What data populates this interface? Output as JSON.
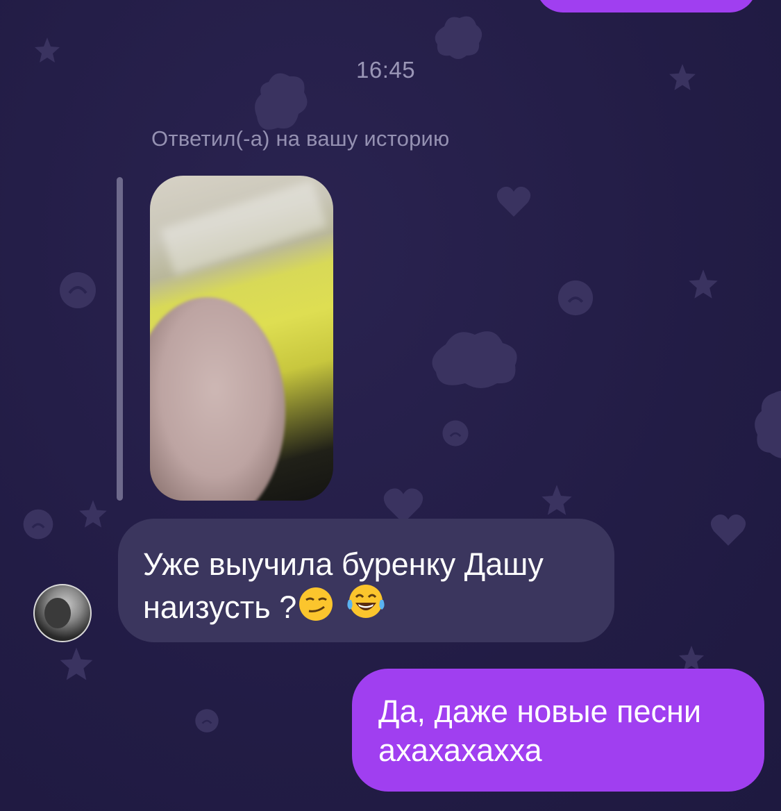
{
  "chat": {
    "timestamp": "16:45",
    "reply_caption": "Ответил(-а) на вашу историю",
    "incoming_message": {
      "text": "Уже выучила буренку Дашу наизусть ?",
      "emojis": [
        "smirking-face-emoji",
        "tears-of-joy-emoji"
      ]
    },
    "outgoing_message": {
      "line1": "Да, даже новые песни",
      "line2": "ахахахахха"
    },
    "colors": {
      "background": "#221c45",
      "incoming_bubble": "#3b365e",
      "outgoing_bubble": "#a03ff0",
      "secondary_text": "#9a96b6"
    }
  }
}
